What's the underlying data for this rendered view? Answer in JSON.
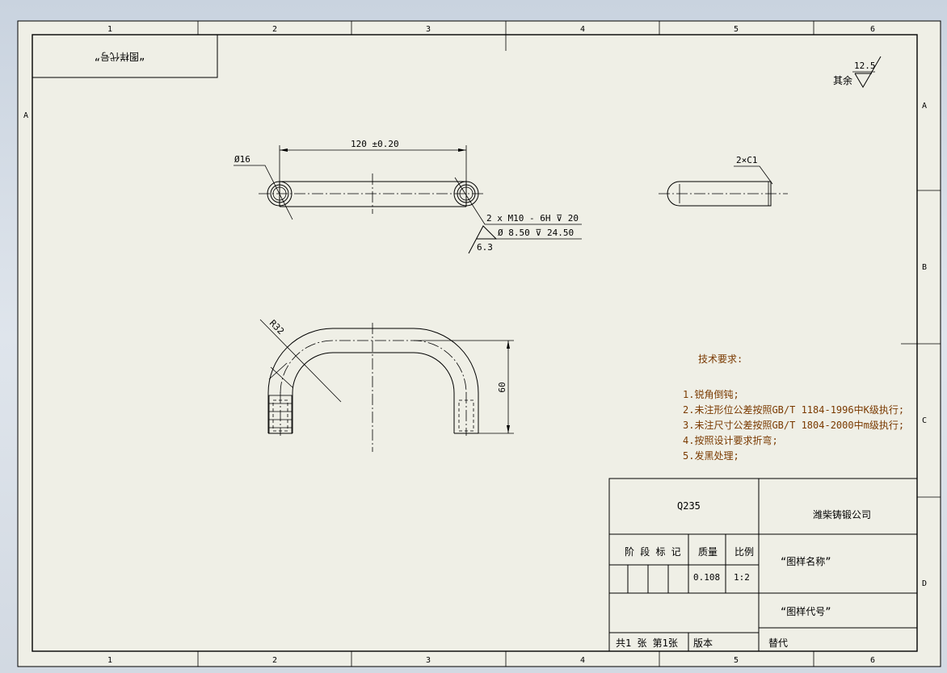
{
  "sheet": {
    "zones_top": [
      "1",
      "2",
      "3",
      "4",
      "5",
      "6"
    ],
    "zones_side": [
      "A",
      "B",
      "C",
      "D"
    ],
    "drawing_number_box": "“图样代号”",
    "surface_finish": {
      "prefix": "其余",
      "value": "12.5"
    }
  },
  "dimensions": {
    "length": "120 ±0.20",
    "diameter": "Ø16",
    "thread": "2 x M10 - 6H ⊽ 20",
    "drill": "Ø 8.50 ⊽ 24.50",
    "roughness": "6.3",
    "chamfer": "2×C1",
    "radius": "R32",
    "height": "60"
  },
  "technical_requirements": {
    "title": "技术要求:",
    "items": [
      "1.锐角倒钝;",
      "2.未注形位公差按照GB/T 1184-1996中K级执行;",
      "3.未注尺寸公差按照GB/T 1804-2000中m级执行;",
      "4.按照设计要求折弯;",
      "5.发黑处理;"
    ]
  },
  "title_block": {
    "material": "Q235",
    "company": "潍柴铸锻公司",
    "stage_label": "阶 段 标 记",
    "mass_label": "质量",
    "scale_label": "比例",
    "mass": "0.108",
    "scale": "1:2",
    "drawing_name": "“图样名称”",
    "drawing_code": "“图样代号”",
    "sheets": "共1 张   第1张",
    "version": "版本",
    "replace": "替代"
  }
}
